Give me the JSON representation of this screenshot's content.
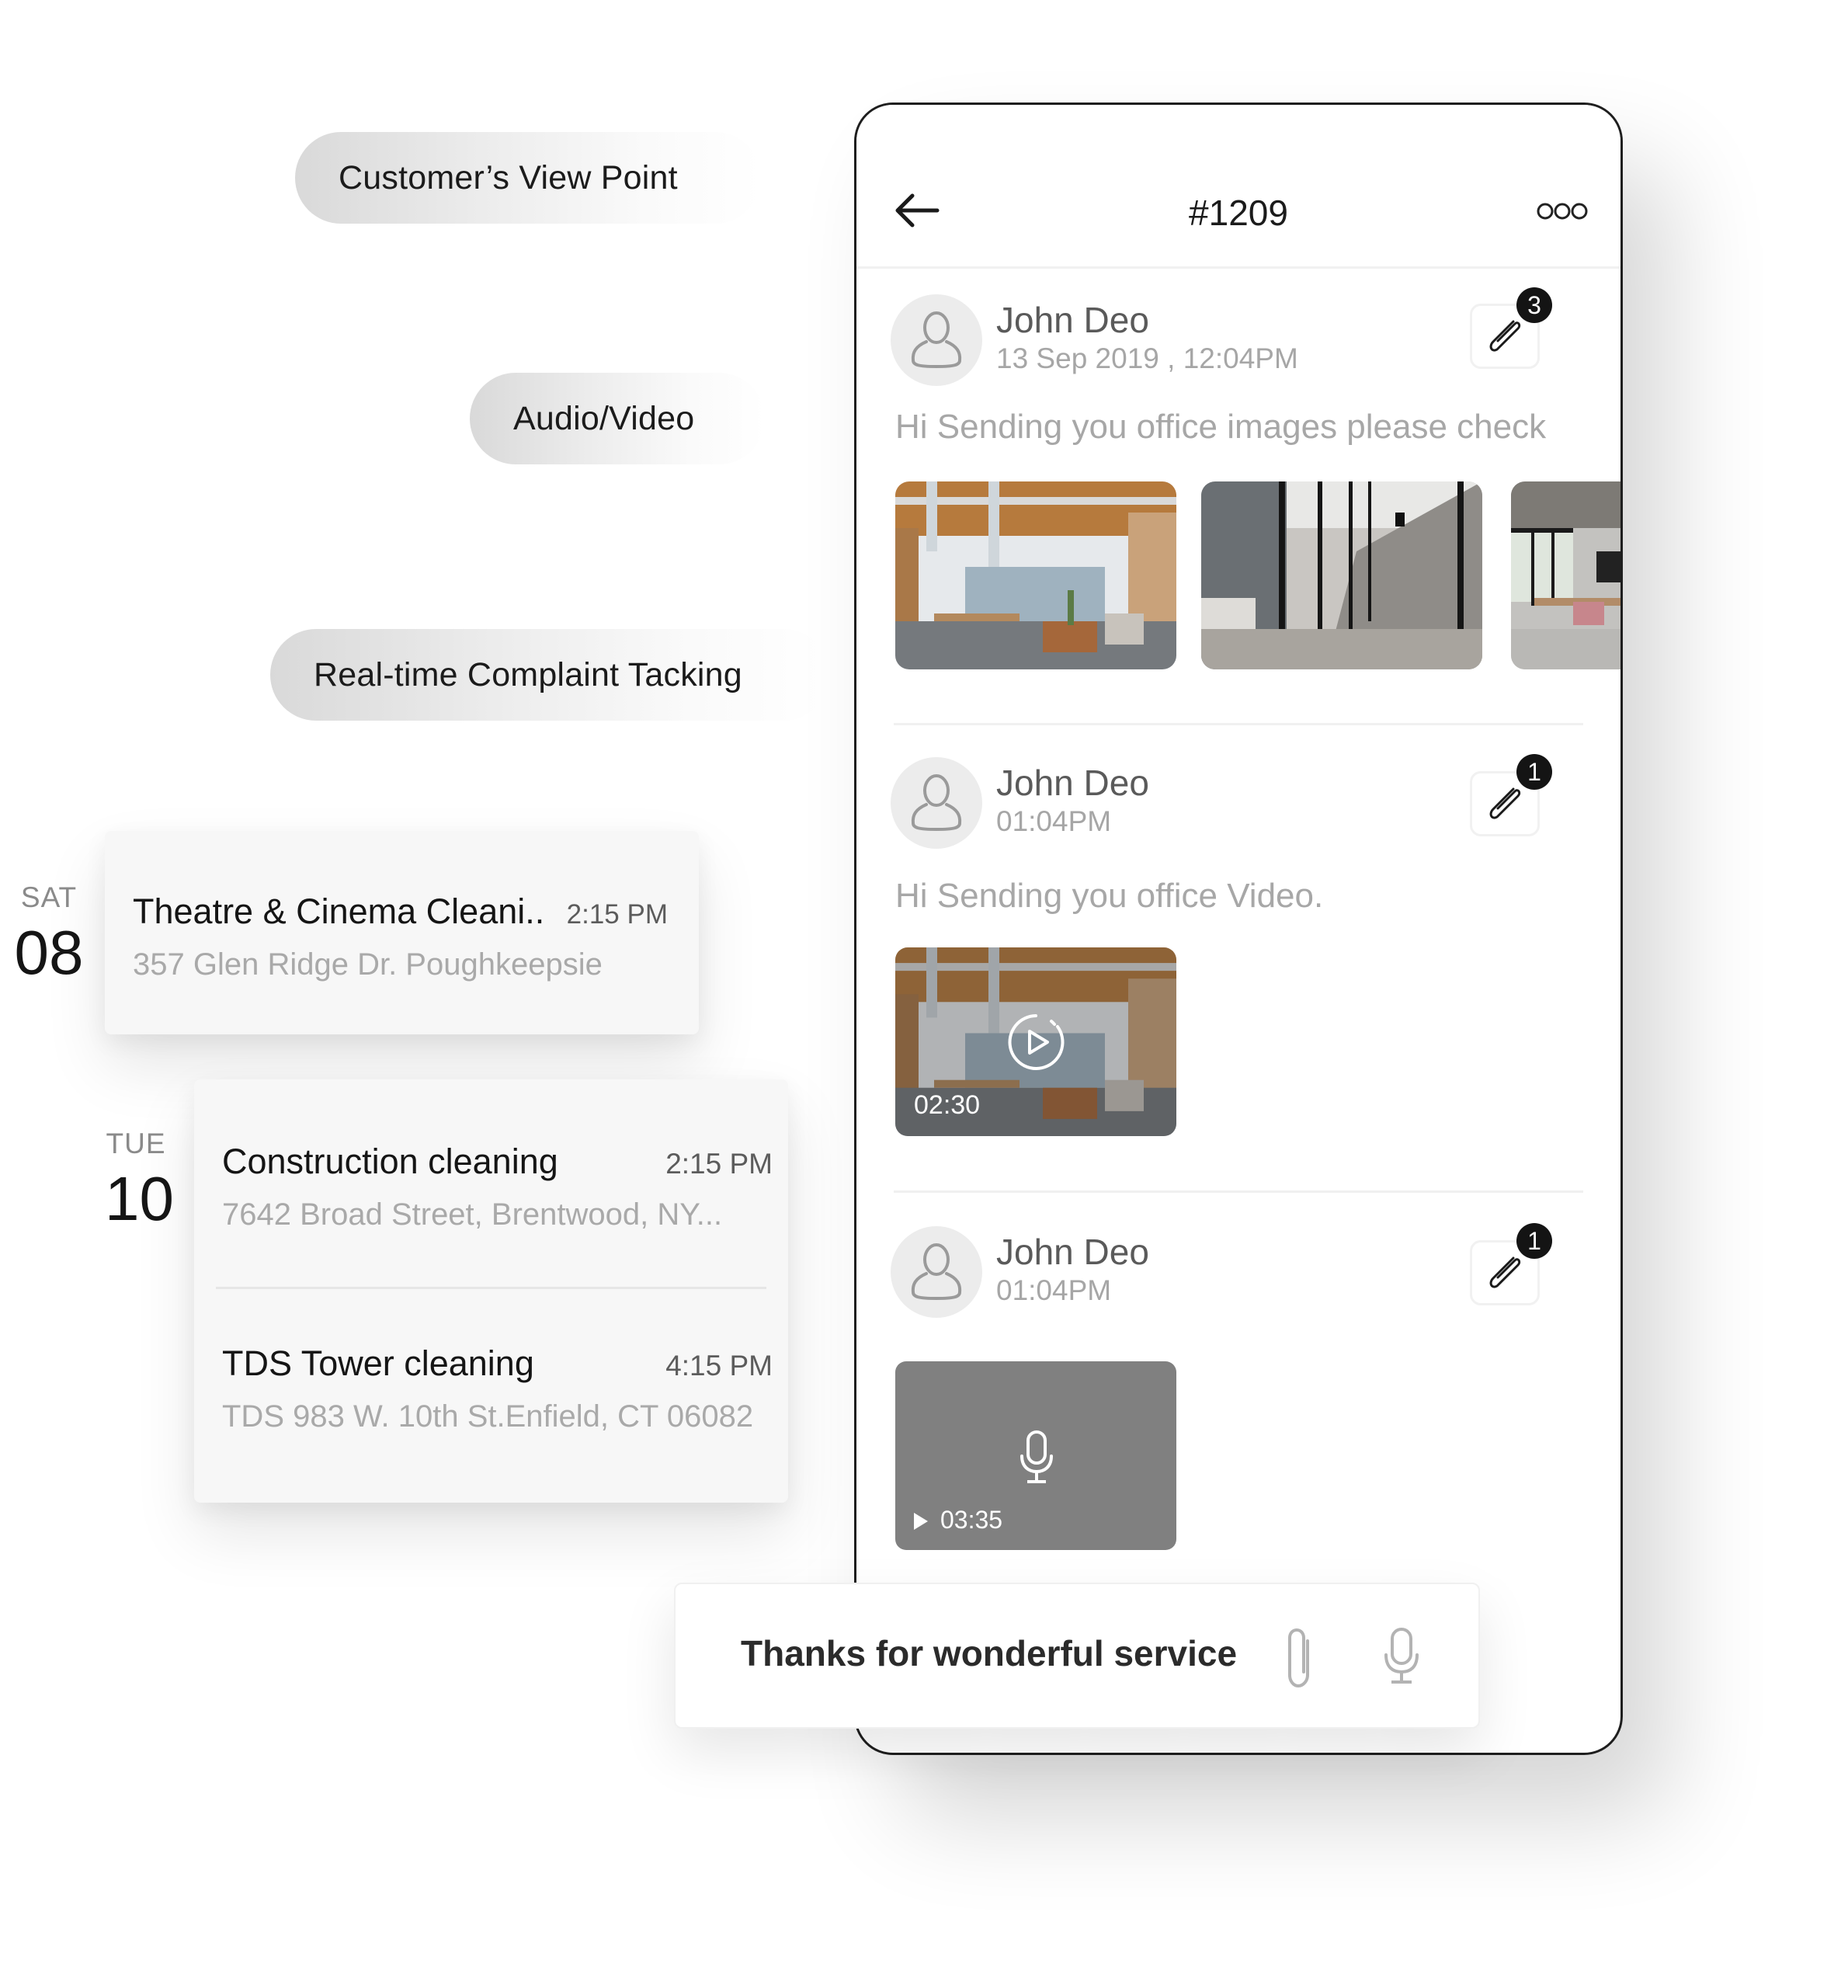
{
  "features": [
    {
      "label": "Customer’s View Point"
    },
    {
      "label": "Audio/Video"
    },
    {
      "label": "Real-time Complaint Tacking"
    }
  ],
  "schedule": [
    {
      "day": "SAT",
      "date": "08",
      "jobs": [
        {
          "title": "Theatre & Cinema Cleani..",
          "time": "2:15 PM",
          "address": "357 Glen Ridge Dr. Poughkeepsie"
        }
      ]
    },
    {
      "day": "TUE",
      "date": "10",
      "jobs": [
        {
          "title": "Construction cleaning",
          "time": "2:15 PM",
          "address": "7642 Broad Street, Brentwood, NY..."
        },
        {
          "title": "TDS Tower cleaning",
          "time": "4:15 PM",
          "address": "TDS 983 W. 10th St.Enfield, CT 06082"
        }
      ]
    }
  ],
  "phone": {
    "header": {
      "title": "#1209",
      "back_icon": "arrow-left-icon",
      "more_icon": "more-options-icon"
    },
    "messages": [
      {
        "sender": "John Deo",
        "timestamp": "13 Sep 2019 , 12:04PM",
        "attachment_count": "3",
        "text": "Hi Sending you office images please check",
        "media_type": "images",
        "images": [
          "office-open-workspace",
          "office-glass-corridor",
          "office-meeting-room"
        ]
      },
      {
        "sender": "John Deo",
        "timestamp": "01:04PM",
        "attachment_count": "1",
        "text": "Hi Sending you office Video.",
        "media_type": "video",
        "duration": "02:30"
      },
      {
        "sender": "John Deo",
        "timestamp": "01:04PM",
        "attachment_count": "1",
        "text": "",
        "media_type": "audio",
        "duration": "03:35"
      }
    ]
  },
  "input": {
    "value": "Thanks for wonderful service",
    "attach_icon": "paperclip-icon",
    "mic_icon": "microphone-icon"
  },
  "colors": {
    "badge": "#141414",
    "audio_bg": "#808080",
    "muted_text": "#a7a7a7",
    "frame": "#1e1e1e"
  }
}
